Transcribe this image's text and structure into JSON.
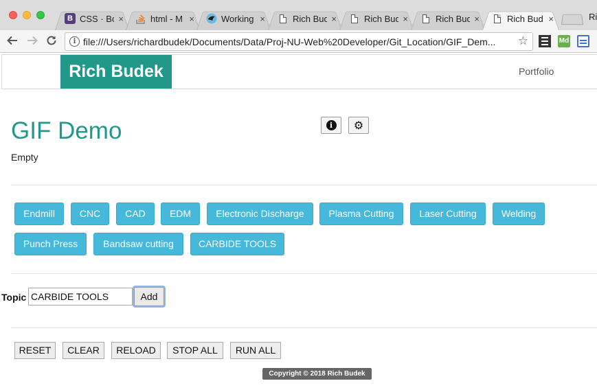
{
  "browser": {
    "tabs": [
      {
        "title": "CSS · Bo",
        "favicon": "bootstrap-icon"
      },
      {
        "title": "html - M",
        "favicon": "stackoverflow-icon"
      },
      {
        "title": "Working",
        "favicon": "bird-icon"
      },
      {
        "title": "Rich Bud",
        "favicon": "document-icon"
      },
      {
        "title": "Rich Bud",
        "favicon": "document-icon"
      },
      {
        "title": "Rich Bud",
        "favicon": "document-icon"
      },
      {
        "title": "Rich Bud",
        "favicon": "document-icon",
        "active": true
      }
    ],
    "close_glyph": "×",
    "profile_text": "Ri",
    "url": "file:///Users/richardbudek/Documents/Data/Proj-NU-Web%20Developer/Git_Location/GIF_Dem...",
    "extensions": {
      "md_label": "Md"
    }
  },
  "navbar": {
    "brand": "Rich Budek",
    "links": [
      "Portfolio"
    ],
    "brand_color": "#21988a"
  },
  "main": {
    "title": "GIF Demo",
    "subtitle": "Empty",
    "topic_buttons": [
      "Endmill",
      "CNC",
      "CAD",
      "EDM",
      "Electronic Discharge",
      "Plasma Cutting",
      "Laser Cutting",
      "Welding",
      "Punch Press",
      "Bandsaw cutting",
      "CARBIDE TOOLS"
    ],
    "topic_color": "#46b8da"
  },
  "form": {
    "label": "Topic",
    "input_value": "CARBIDE TOOLS",
    "add_label": "Add"
  },
  "controls": [
    "RESET",
    "CLEAR",
    "RELOAD",
    "STOP ALL",
    "RUN ALL"
  ],
  "footer": {
    "text": "Copyright © 2018 Rich Budek"
  }
}
